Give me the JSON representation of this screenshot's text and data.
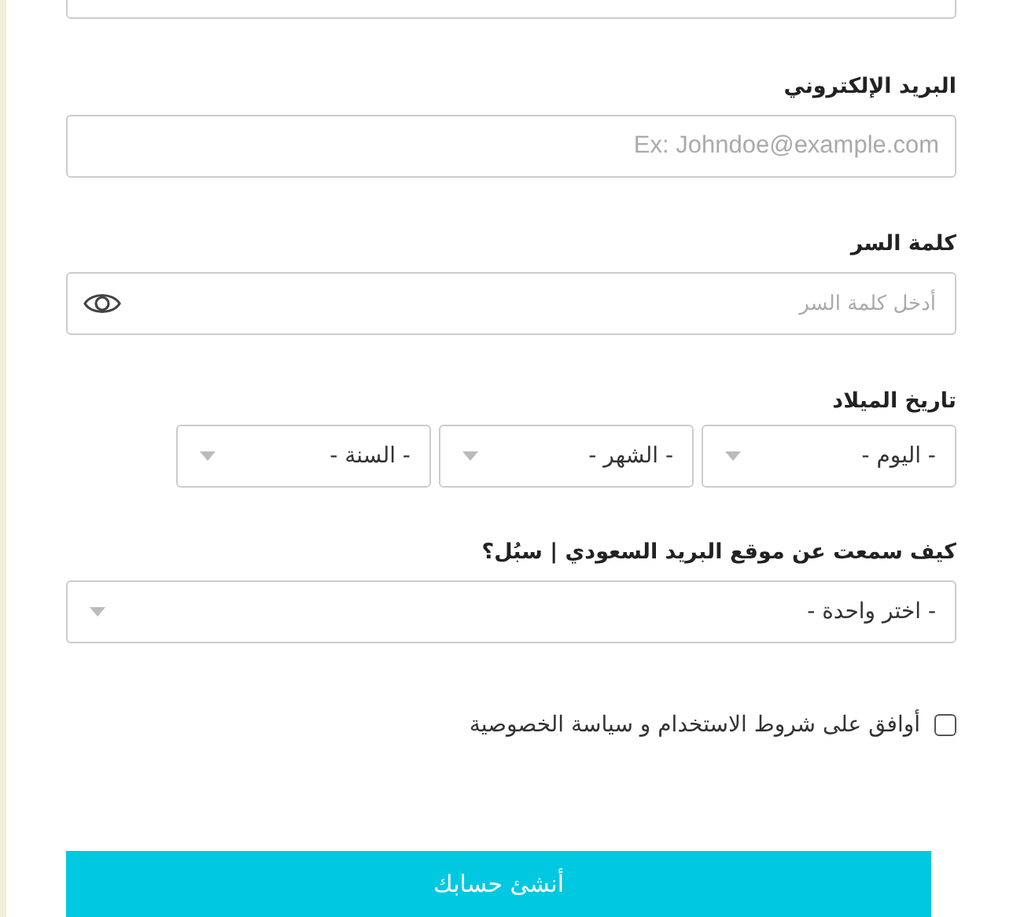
{
  "fields": [
    {
      "kind": "text",
      "label": "البريد الإلكتروني",
      "placeholder": "Ex: Johndoe@example.com"
    },
    {
      "kind": "password",
      "label": "كلمة السر",
      "placeholder": "أدخل كلمة السر"
    },
    {
      "kind": "date",
      "label": "تاريخ الميلاد",
      "selects": [
        "- اليوم -",
        "- الشهر -",
        "- السنة -"
      ]
    },
    {
      "kind": "select",
      "label": "كيف سمعت عن موقع البريد السعودي | سبُل؟",
      "value": "- اختر واحدة -"
    }
  ],
  "agreement": {
    "label": "أوافق على شروط الاستخدام و سياسة الخصوصية",
    "checked": false
  },
  "submit": {
    "label": "أنشئ حسابك"
  }
}
